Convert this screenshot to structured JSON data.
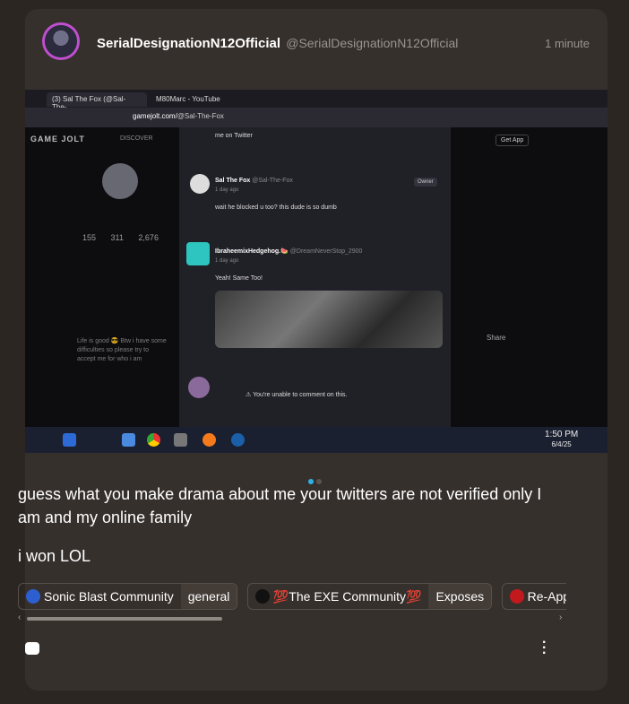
{
  "post": {
    "author_name": "SerialDesignationN12Official",
    "author_handle": "@SerialDesignationN12Official",
    "time": "1 minute",
    "text_line1": "guess what you make drama about me your twitters are not verified only I am and my online family",
    "text_line2": "i won LOL"
  },
  "screenshot": {
    "tab1": "(3) Sal The Fox (@Sal-The-...",
    "tab2": "M80Marc - YouTube",
    "url_prefix": "gamejolt.com/",
    "url_path": "@Sal-The-Fox",
    "logo": "GAME JOLT",
    "discover": "DISCOVER",
    "get_app": "Get App",
    "stats": [
      "155",
      "311",
      "2,676"
    ],
    "life_text": "Life is good 😎 Btw i have some difficulties so please try to accept me for who i am",
    "top_comment_text": "me on Twitter",
    "c1_name": "Sal The Fox",
    "c1_handle": "@Sal-The-Fox",
    "c1_time": "1 day ago",
    "c1_badge": "Owner",
    "c1_text": "wait he blocked u too? this dude is so dumb",
    "c2_name": "IbraheemixHedgehog.🍉",
    "c2_handle": "@DreamNeverStop_2900",
    "c2_time": "1 day ago",
    "c2_text": "Yeah! Same Too!",
    "unable": "You're unable to comment on this.",
    "share": "Share",
    "clock_time": "1:50 PM",
    "clock_date": "6/4/25"
  },
  "communities": [
    {
      "name": "Sonic Blast Community",
      "channel": "general",
      "color": "#2d5fd1"
    },
    {
      "name": "💯The EXE Community💯",
      "channel": "Exposes",
      "color": "#111111"
    },
    {
      "name": "Re-Applicati",
      "channel": "",
      "color": "#c2191f"
    }
  ],
  "colors": {
    "accent": "#2fb2e8",
    "card": "#36302c",
    "background": "#2b2622"
  }
}
